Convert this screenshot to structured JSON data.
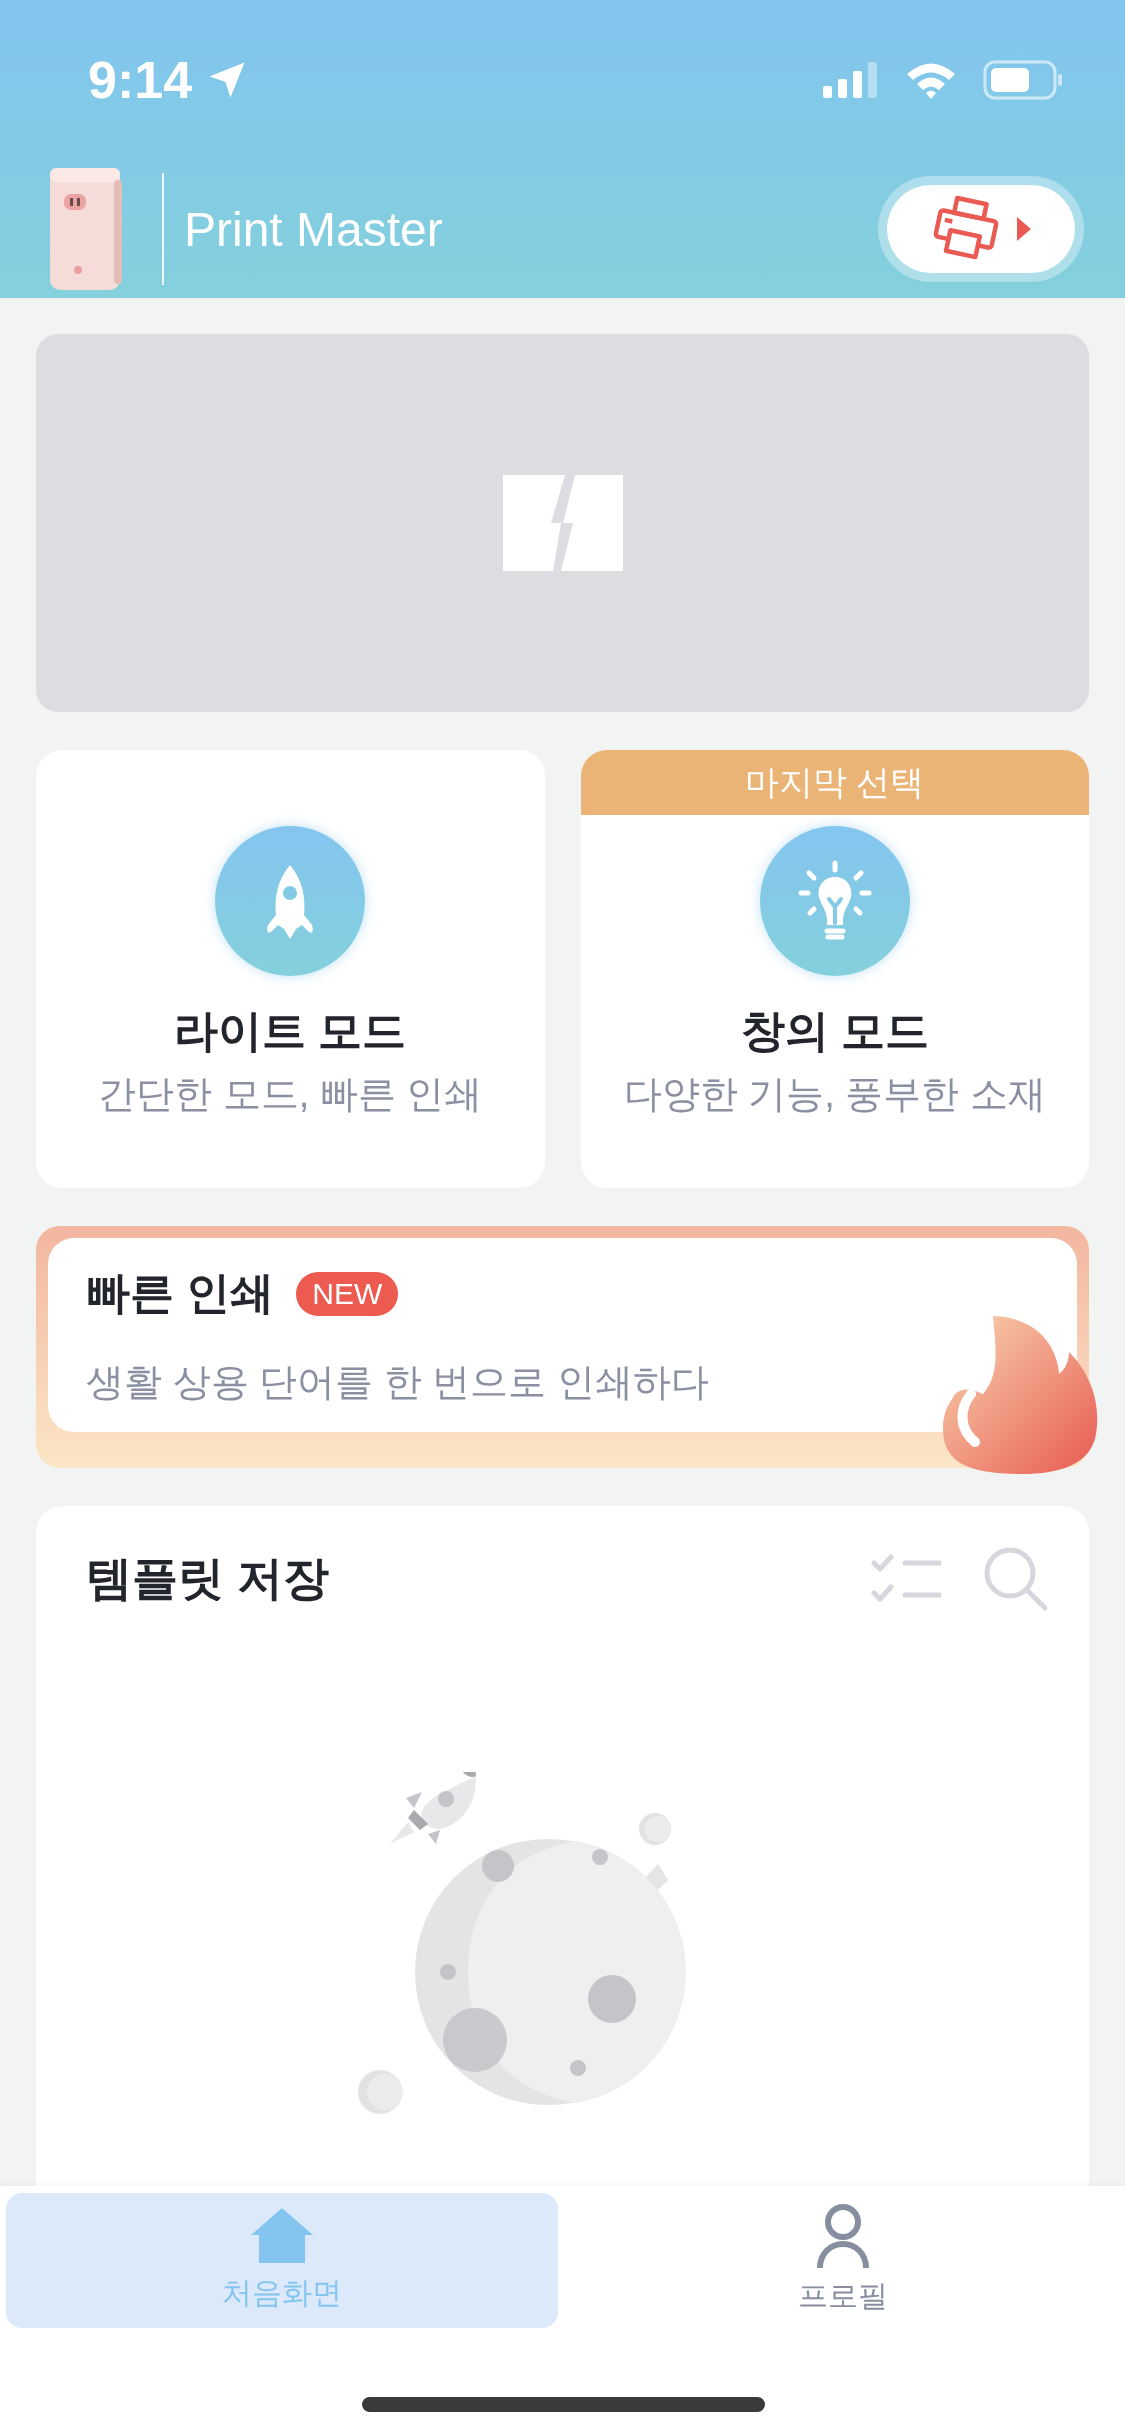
{
  "status_bar": {
    "time": "9:14"
  },
  "header": {
    "title": "Print Master"
  },
  "modes": [
    {
      "kind": "rocket",
      "title": "라이트 모드",
      "subtitle": "간단한 모드, 빠른 인쇄"
    },
    {
      "kind": "bulb",
      "title": "창의 모드",
      "subtitle": "다양한 기능, 풍부한 소재",
      "ribbon": "마지막 선택"
    }
  ],
  "quick_print": {
    "title": "빠른 인쇄",
    "badge": "NEW",
    "description": "생활 상용 단어를 한 번으로 인쇄하다"
  },
  "templates": {
    "title": "템플릿 저장"
  },
  "nav": [
    {
      "kind": "home",
      "label": "처음화면",
      "selected": true
    },
    {
      "kind": "profile",
      "label": "프로필",
      "selected": false
    }
  ]
}
